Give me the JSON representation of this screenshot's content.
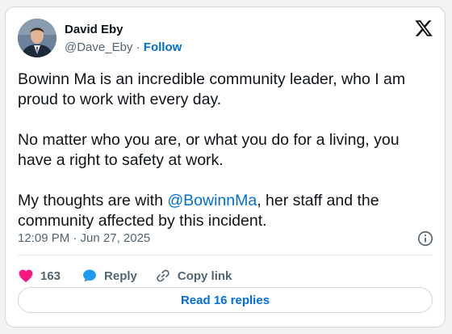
{
  "author": {
    "name": "David Eby",
    "handle": "@Dave_Eby",
    "separator": "·",
    "follow_label": "Follow"
  },
  "tweet": {
    "paragraph_1": "Bowinn Ma is an incredible community leader, who I am proud to work with every day.",
    "paragraph_2": "No matter who you are, or what you do for a living, you have a right to safety at work.",
    "paragraph_3_before": "My thoughts are with ",
    "mention": "@BowinnMa",
    "paragraph_3_after": ", her staff and the community affected by this incident.",
    "timestamp": "12:09 PM · Jun 27, 2025"
  },
  "actions": {
    "like_count": "163",
    "reply_label": "Reply",
    "copy_link_label": "Copy link"
  },
  "read_replies_label": "Read 16 replies",
  "colors": {
    "like": "#f91880",
    "reply": "#1d9bf0",
    "link": "#006fd6"
  },
  "icons": [
    "x-logo-icon",
    "info-icon",
    "heart-icon",
    "reply-bubble-icon",
    "link-icon"
  ]
}
